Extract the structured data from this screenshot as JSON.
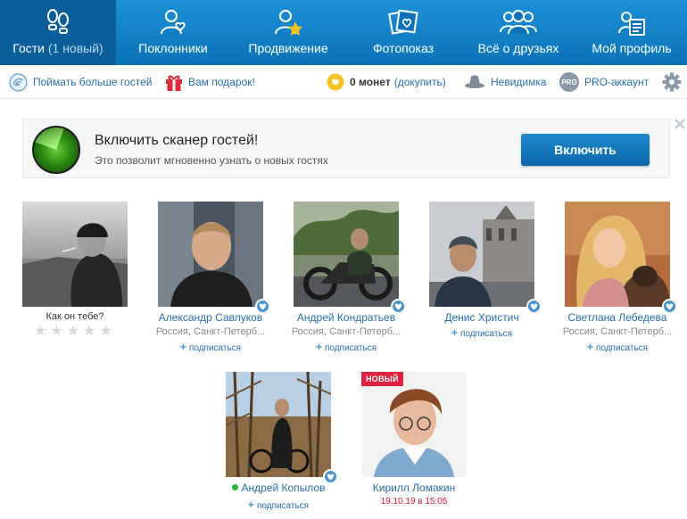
{
  "nav": {
    "tabs": [
      {
        "label": "Гости",
        "sub": "(1 новый)",
        "icon": "footprints-icon"
      },
      {
        "label": "Поклонники",
        "icon": "person-heart-icon"
      },
      {
        "label": "Продвижение",
        "icon": "person-star-icon"
      },
      {
        "label": "Фотопоказ",
        "icon": "photos-heart-icon"
      },
      {
        "label": "Всё о друзьях",
        "icon": "friends-group-icon"
      },
      {
        "label": "Мой профиль",
        "icon": "profile-card-icon"
      }
    ]
  },
  "toolbar": {
    "catch_guests": "Поймать больше гостей",
    "gift": "Вам подарок!",
    "coins_value": "0 монет",
    "coins_topup": "(докупить)",
    "invisible": "Невидимка",
    "pro_badge": "PRO",
    "pro_account": "PRO-аккаунт"
  },
  "banner": {
    "title": "Включить сканер гостей!",
    "subtitle": "Это позволит мгновенно узнать о новых гостях",
    "button": "Включить"
  },
  "guests": [
    {
      "rate_question": "Как он тебе?",
      "stars": 5
    },
    {
      "name": "Александр Савлуков",
      "location": "Россия, Санкт-Петерб...",
      "subscribe": "подписаться"
    },
    {
      "name": "Андрей Кондратьев",
      "location": "Россия, Санкт-Петерб...",
      "subscribe": "подписаться"
    },
    {
      "name": "Денис Христич",
      "subscribe": "подписаться"
    },
    {
      "name": "Светлана Лебедева",
      "location": "Россия, Санкт-Петерб...",
      "subscribe": "подписаться"
    },
    {
      "name": "Андрей Копылов",
      "subscribe": "подписаться",
      "online": true
    },
    {
      "name": "Кирилл Ломакин",
      "badge": "НОВЫЙ",
      "date": "19.10.19 в 15:05"
    }
  ],
  "colors": {
    "nav_bg": "#0c73b8",
    "link": "#2a6ea8",
    "new_badge": "#e0213f",
    "online": "#27b534"
  }
}
